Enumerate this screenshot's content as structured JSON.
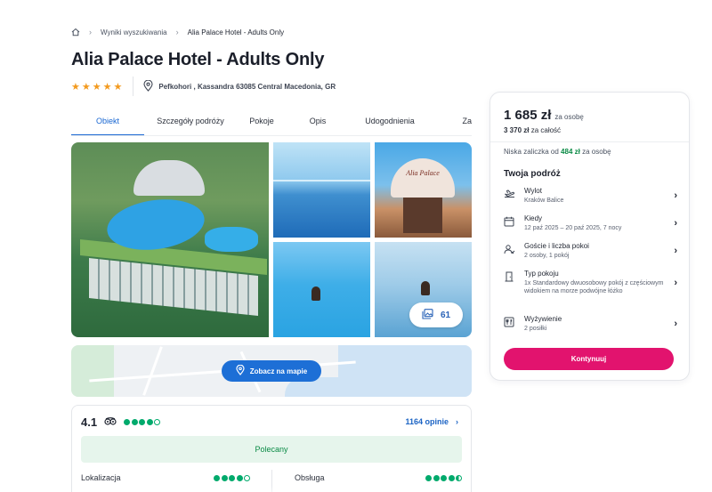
{
  "breadcrumb": {
    "home_icon": "home-icon",
    "items": [
      "Wyniki wyszukiwania",
      "Alia Palace Hotel - Adults Only"
    ]
  },
  "hotel": {
    "name": "Alia Palace Hotel - Adults Only",
    "stars": 5,
    "address": "Pefkohori , Kassandra 63085 Central Macedonia, GR"
  },
  "tabs": [
    {
      "label": "Obiekt",
      "active": true
    },
    {
      "label": "Szczegóły podróży",
      "active": false
    },
    {
      "label": "Pokoje",
      "active": false
    },
    {
      "label": "Opis",
      "active": false
    },
    {
      "label": "Udogodnienia",
      "active": false
    },
    {
      "label": "Za",
      "active": false
    }
  ],
  "gallery": {
    "photo_count": "61",
    "sign_text": "Alia Palace"
  },
  "map": {
    "button_label": "Zobacz na mapie"
  },
  "reviews": {
    "score": "4.1",
    "count_label": "1164 opinie",
    "recommended_label": "Polecany",
    "criteria": [
      {
        "label": "Lokalizacja",
        "bubbles": 4
      },
      {
        "label": "Obsługa",
        "bubbles": 4.5
      }
    ]
  },
  "booking": {
    "price": "1 685 zł",
    "price_per": "za osobę",
    "total_value": "3 370 zł",
    "total_suffix": "za całość",
    "deposit_prefix": "Niska zaliczka od",
    "deposit_value": "484 zł",
    "deposit_suffix": "za osobę",
    "trip_title": "Twoja podróż",
    "items": [
      {
        "icon": "plane-icon",
        "label": "Wylot",
        "value": "Kraków Balice"
      },
      {
        "icon": "calendar-icon",
        "label": "Kiedy",
        "value": "12 paź 2025 – 20 paź 2025, 7 nocy"
      },
      {
        "icon": "guests-icon",
        "label": "Goście i liczba pokoi",
        "value": "2 osoby, 1 pokój"
      },
      {
        "icon": "door-icon",
        "label": "Typ pokoju",
        "value": "1x Standardowy dwuosobowy pokój z częściowym widokiem na morze podwójne łóżko"
      },
      {
        "icon": "utensils-icon",
        "label": "Wyżywienie",
        "value": "2 posiłki"
      }
    ],
    "continue_label": "Kontynuuj"
  },
  "colors": {
    "accent_blue": "#1967d2",
    "cta_pink": "#e2136e",
    "star_orange": "#f39a1e",
    "tripadvisor_green": "#00aa6c",
    "recommended_green": "#0a8a45"
  }
}
